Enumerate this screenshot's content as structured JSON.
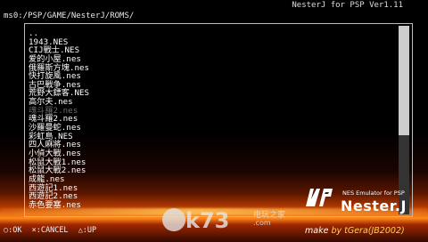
{
  "window": {
    "title": "NesterJ for PSP Ver1.11"
  },
  "browser": {
    "path": "ms0:/PSP/GAME/NesterJ/ROMS/",
    "files": [
      "..",
      "1943.NES",
      "CIJ戰士.NES",
      "爱的小屋.nes",
      "俄羅斯方塊.nes",
      "快打旋風.nes",
      "古巴戰争.nes",
      "荒野大鏢客.NES",
      "高尔夫.nes",
      "魂斗羅2.nes",
      "魂斗羅2.nes",
      "沙羅曼蛇.nes",
      "彩虹島.NES",
      "四人麻將.nes",
      "小偵大戰.nes",
      "松鼠大戰1.nes",
      "松鼠大戰2.nes",
      "成龍.nes",
      "西遊記1.nes",
      "西遊記2.nes",
      "赤色要塞.nes"
    ],
    "selected_index": 9,
    "scroll_fraction": 0.58
  },
  "help": {
    "ok": "○:OK",
    "cancel": "×:CANCEL",
    "up": "△:UP"
  },
  "logo": {
    "subtitle": "NES Emulator for PSP",
    "name": "Nester.J"
  },
  "credit": {
    "prefix": "make ",
    "author": "by tGera(JB2002)",
    "full": "make by tGera(JB2002)"
  },
  "watermark": {
    "text": "k73",
    "suffix": ".com",
    "cn": "电玩之家"
  },
  "colors": {
    "accent_orange": "#ff8a1a",
    "selected_text": "#6a6a6a",
    "frame": "#bbbbbb"
  }
}
